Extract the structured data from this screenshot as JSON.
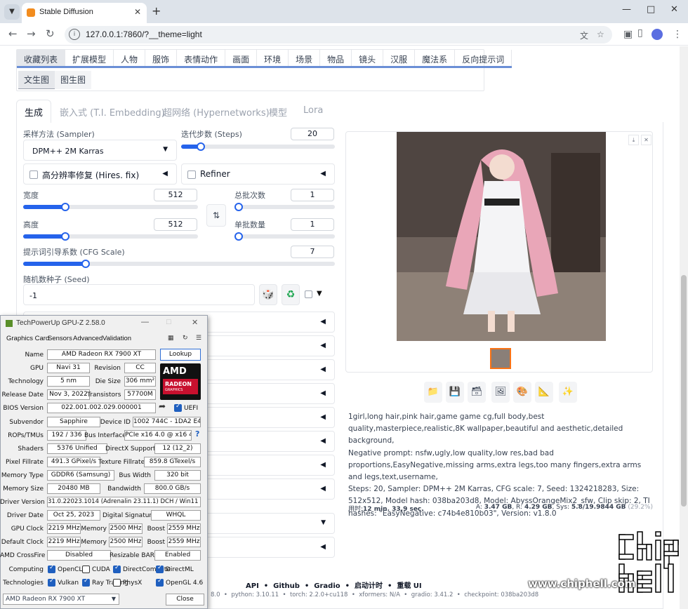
{
  "browser": {
    "tab_title": "Stable Diffusion",
    "url": "127.0.0.1:7860/?__theme=light",
    "new_tab": "+",
    "minimize": "—",
    "maximize": "□",
    "close": "✕"
  },
  "categories": [
    "收藏列表",
    "扩展模型",
    "人物",
    "服饰",
    "表情动作",
    "画面",
    "环境",
    "场景",
    "物品",
    "镜头",
    "汉服",
    "魔法系",
    "反向提示词"
  ],
  "subtabs": [
    "文生图",
    "图生图"
  ],
  "main_tabs": [
    "生成",
    "嵌入式 (T.I. Embedding)",
    "超网络 (Hypernetworks)",
    "模型",
    "Lora"
  ],
  "sampler": {
    "label": "采样方法 (Sampler)",
    "value": "DPM++ 2M Karras"
  },
  "steps": {
    "label": "迭代步数 (Steps)",
    "value": "20",
    "fraction": 0.13
  },
  "hires": {
    "label": "高分辨率修复 (Hires. fix)"
  },
  "refiner": {
    "label": "Refiner"
  },
  "width": {
    "label": "宽度",
    "value": "512",
    "fraction": 0.24
  },
  "height": {
    "label": "高度",
    "value": "512",
    "fraction": 0.24
  },
  "batch_count": {
    "label": "总批次数",
    "value": "1",
    "fraction": 0.0
  },
  "batch_size": {
    "label": "单批数量",
    "value": "1",
    "fraction": 0.0
  },
  "cfg": {
    "label": "提示词引导系数 (CFG Scale)",
    "value": "7",
    "fraction": 0.2
  },
  "seed": {
    "label": "随机数种子 (Seed)",
    "value": "-1"
  },
  "swap_icon": "⇅",
  "dice_icon": "🎲",
  "recycle_icon": "♻",
  "extra_arrow": "▼",
  "accordion_arrow": "◀",
  "gallery": {
    "download": "⤓",
    "close": "✕"
  },
  "actions": [
    "📁",
    "💾",
    "🗃",
    "🖼",
    "🎨",
    "📐",
    "✨"
  ],
  "generation_info": {
    "prompt": "1girl,long hair,pink hair,game game cg,full body,best quality,masterpiece,realistic,8K wallpaper,beautiful and aesthetic,detailed background,",
    "negative": "Negative prompt: nsfw,ugly,low quality,low res,bad bad proportions,EasyNegative,missing arms,extra legs,too many fingers,extra arms and legs,text,username,",
    "params": "Steps: 20, Sampler: DPM++ 2M Karras, CFG scale: 7, Seed: 1324218283, Size: 512x512, Model hash: 038ba203d8, Model: AbyssOrangeMix2_sfw, Clip skip: 2, TI hashes: \"EasyNegative: c74b4e810b03\", Version: v1.8.0"
  },
  "stats": {
    "time_label": "用时:",
    "time_value": "12 min. 33.9 sec.",
    "a_label": "A:",
    "a_value": "3.47 GB",
    "r_label": ", R:",
    "r_value": "4.29 GB",
    "sys_label": ", Sys:",
    "sys_value": "5.8/19.9844 GB",
    "sys_pct": "(29.2%)"
  },
  "footer": {
    "links": [
      "API",
      "Github",
      "Gradio",
      "启动计时",
      "重载 UI"
    ],
    "sep": "•",
    "version_frag": "8.0",
    "python": "python: 3.10.11",
    "torch": "torch: 2.2.0+cu118",
    "xformers": "xformers: N/A",
    "gradio": "gradio: 3.41.2",
    "checkpoint": "checkpoint: 038ba203d8"
  },
  "gpuz": {
    "title": "TechPowerUp GPU-Z 2.58.0",
    "menu": [
      "Graphics Card",
      "Sensors",
      "Advanced",
      "Validation"
    ],
    "lookup": "Lookup",
    "close_btn": "Close",
    "uefi": "UEFI",
    "logo_amd": "AMD",
    "logo_radeon": "RADEON",
    "logo_graphics": "GRAPHICS",
    "gpu_select": "AMD Radeon RX 7900 XT",
    "name": {
      "label": "Name",
      "value": "AMD Radeon RX 7900 XT"
    },
    "gpu": {
      "label": "GPU",
      "value": "Navi 31"
    },
    "revision": {
      "label": "Revision",
      "value": "CC"
    },
    "technology": {
      "label": "Technology",
      "value": "5 nm"
    },
    "die_size": {
      "label": "Die Size",
      "value": "306 mm²"
    },
    "release_date": {
      "label": "Release Date",
      "value": "Nov 3, 2022"
    },
    "transistors": {
      "label": "Transistors",
      "value": "57700M"
    },
    "bios": {
      "label": "BIOS Version",
      "value": "022.001.002.029.000001"
    },
    "subvendor": {
      "label": "Subvendor",
      "value": "Sapphire"
    },
    "device_id": {
      "label": "Device ID",
      "value": "1002 744C - 1DA2 E471"
    },
    "rops": {
      "label": "ROPs/TMUs",
      "value": "192 / 336"
    },
    "bus_interface": {
      "label": "Bus Interface",
      "value": "PCIe x16 4.0 @ x16 4.0"
    },
    "shaders": {
      "label": "Shaders",
      "value": "5376 Unified"
    },
    "directx": {
      "label": "DirectX Support",
      "value": "12 (12_2)"
    },
    "pixel_fill": {
      "label": "Pixel Fillrate",
      "value": "491.3 GPixel/s"
    },
    "texture_fill": {
      "label": "Texture Fillrate",
      "value": "859.8 GTexel/s"
    },
    "memory_type": {
      "label": "Memory Type",
      "value": "GDDR6 (Samsung)"
    },
    "bus_width": {
      "label": "Bus Width",
      "value": "320 bit"
    },
    "memory_size": {
      "label": "Memory Size",
      "value": "20480 MB"
    },
    "bandwidth": {
      "label": "Bandwidth",
      "value": "800.0 GB/s"
    },
    "driver_version": {
      "label": "Driver Version",
      "value": "31.0.22023.1014 (Adrenalin 23.11.1) DCH / Win11 64"
    },
    "driver_date": {
      "label": "Driver Date",
      "value": "Oct 25, 2023"
    },
    "digital_sig": {
      "label": "Digital Signature",
      "value": "WHQL"
    },
    "gpu_clock": {
      "label": "GPU Clock",
      "value": "2219 MHz"
    },
    "memory_clock": {
      "label": "Memory",
      "value": "2500 MHz"
    },
    "boost_clock": {
      "label": "Boost",
      "value": "2559 MHz"
    },
    "default_clock": {
      "label": "Default Clock",
      "value": "2219 MHz"
    },
    "default_memory": {
      "label": "Memory",
      "value": "2500 MHz"
    },
    "default_boost": {
      "label": "Boost",
      "value": "2559 MHz"
    },
    "crossfire": {
      "label": "AMD CrossFire",
      "value": "Disabled"
    },
    "resizable_bar": {
      "label": "Resizable BAR",
      "value": "Enabled"
    },
    "computing_label": "Computing",
    "technologies_label": "Technologies",
    "computing": [
      {
        "name": "OpenCL",
        "on": true
      },
      {
        "name": "CUDA",
        "on": false
      },
      {
        "name": "DirectCompute",
        "on": true
      },
      {
        "name": "DirectML",
        "on": true
      }
    ],
    "technologies": [
      {
        "name": "Vulkan",
        "on": true
      },
      {
        "name": "Ray Tracing",
        "on": true
      },
      {
        "name": "PhysX",
        "on": false
      },
      {
        "name": "OpenGL 4.6",
        "on": true
      }
    ]
  },
  "watermark": "www.chiphell.com",
  "colors": {
    "accent": "#2563eb",
    "tab_underline": "#6b8fd6",
    "amd_red": "#c8102e",
    "gpuz_bg": "#f0f0f0"
  }
}
